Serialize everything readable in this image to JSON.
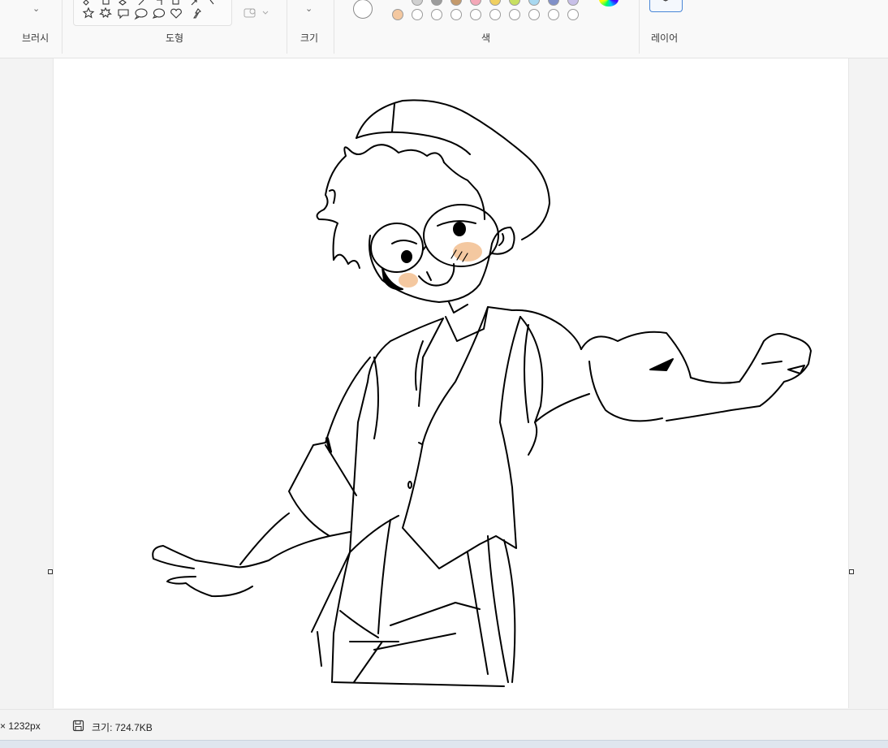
{
  "ribbon": {
    "brush_label": "브러시",
    "shapes_label": "도형",
    "size_label": "크기",
    "color_label": "색",
    "layers_label": "레이어"
  },
  "palette_row_top": [
    "#d0d0d0",
    "#9c9c9c",
    "#c49a6c",
    "#f4a8b8",
    "#f0d060",
    "#c8e060",
    "#a8d8f0",
    "#8090c8",
    "#c8c0e8"
  ],
  "palette_row_bottom": [
    "#f4c8a0",
    "#ffffff",
    "#ffffff",
    "#ffffff",
    "#ffffff",
    "#ffffff",
    "#ffffff",
    "#ffffff",
    "#ffffff",
    "#ffffff"
  ],
  "status": {
    "dimensions": "× 1232px",
    "file_size": "크기: 724.7KB"
  },
  "colors": {
    "accent": "#4a86d6",
    "blush": "#f4c8a0"
  }
}
